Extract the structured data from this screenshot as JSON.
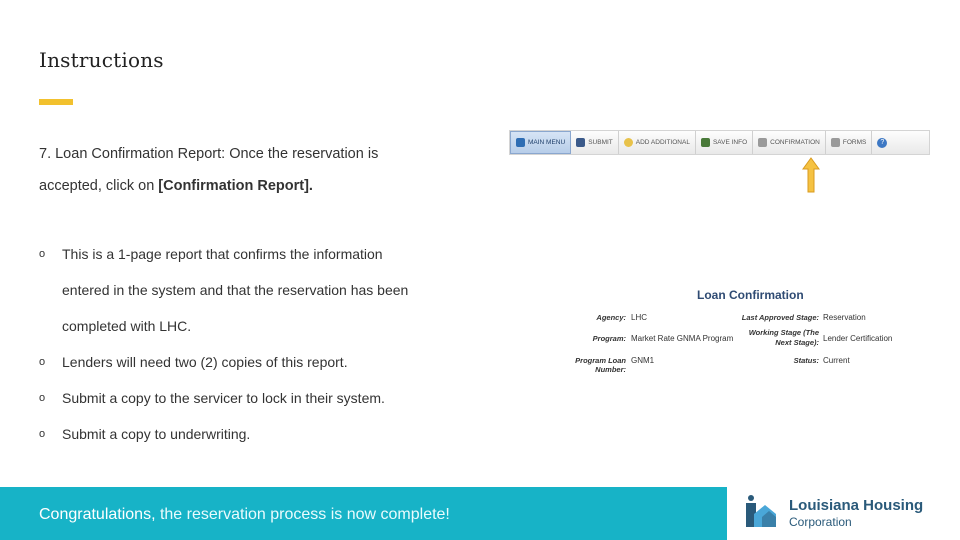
{
  "slide": {
    "title": "Instructions",
    "step_text": "7. Loan Confirmation Report: Once the reservation is",
    "step_text_2_prefix": "accepted, click on ",
    "step_text_2_bold": "[Confirmation Report].",
    "bullets": [
      "This is a 1-page report that confirms the information",
      "entered in the system and that the reservation has been",
      "completed with LHC.",
      "Lenders will need two (2) copies of this report.",
      "Submit a copy to the servicer to lock in their system.",
      "Submit a copy to underwriting."
    ],
    "bullet_mark": "o",
    "footer_bold": "Congratulations,",
    "footer_rest": " the reservation process is now complete!"
  },
  "toolbar": {
    "buttons": [
      "Main Menu",
      "Submit",
      "Add Additional",
      "Save Info",
      "Confirmation",
      "Forms"
    ],
    "help": "?"
  },
  "loan_confirmation": {
    "title": "Loan Confirmation",
    "agency_label": "Agency:",
    "agency_value": "LHC",
    "program_label": "Program:",
    "program_value": "Market Rate GNMA Program",
    "loan_number_label": "Program Loan Number:",
    "loan_number_value": "GNM1",
    "last_stage_label": "Last Approved Stage:",
    "last_stage_value": "Reservation",
    "working_stage_label_1": "Working Stage (The",
    "working_stage_label_2": "Next Stage):",
    "working_stage_value": "Lender Certification",
    "status_label": "Status:",
    "status_value": "Current"
  },
  "logo": {
    "line1": "Louisiana Housing",
    "line2": "Corporation"
  },
  "colors": {
    "accent": "#f2c12e",
    "footer": "#17b3c7",
    "logo_blue": "#2a5a7a"
  }
}
